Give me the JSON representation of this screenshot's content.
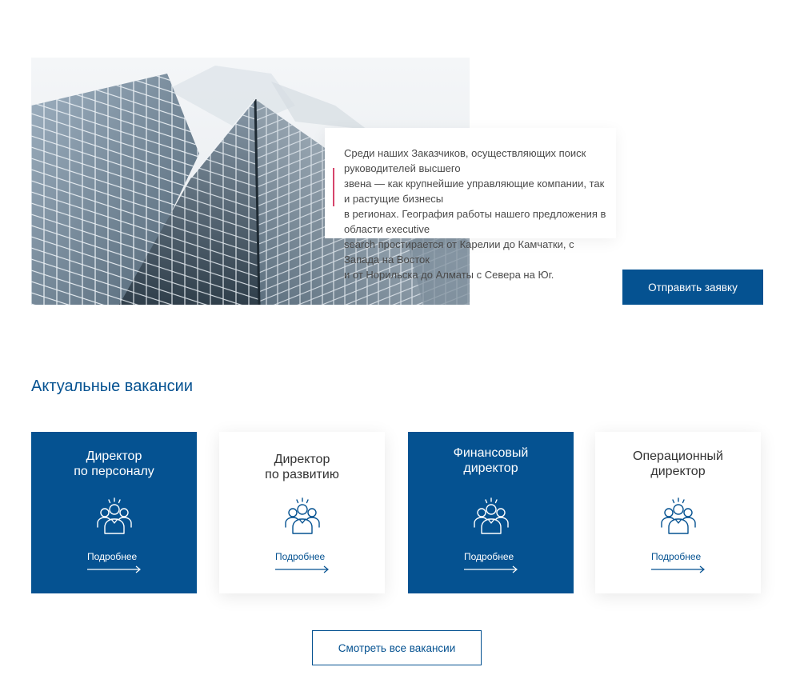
{
  "about": {
    "lines": [
      "Среди наших Заказчиков, осуществляющих поиск руководителей высшего",
      "звена — как крупнейшие управляющие компании, так и растущие бизнесы",
      "в регионах. География работы нашего предложения в области executive",
      "search простирается от Карелии до Камчатки, с Запада на Восток",
      "и от Норильска до Алматы с Севера на Юг."
    ],
    "button_label": "Отправить заявку"
  },
  "vacancies": {
    "title": "Актуальные вакансии",
    "cards": [
      {
        "title_line1": "Директор",
        "title_line2": "по персоналу",
        "link": "Подробнее",
        "style": "blue"
      },
      {
        "title_line1": "Директор",
        "title_line2": "по развитию",
        "link": "Подробнее",
        "style": "white"
      },
      {
        "title_line1": "Финансовый",
        "title_line2": "директор",
        "link": "Подробнее",
        "style": "blue"
      },
      {
        "title_line1": "Операционный",
        "title_line2": "директор",
        "link": "Подробнее",
        "style": "white"
      }
    ],
    "all_button_label": "Смотреть все вакансии"
  },
  "colors": {
    "brand_blue": "#055291",
    "accent_pink": "#d6456b",
    "text_gray": "#4a4a4a"
  },
  "icons": {
    "card_icon": "team-people-icon",
    "card_arrow": "arrow-right-icon"
  }
}
